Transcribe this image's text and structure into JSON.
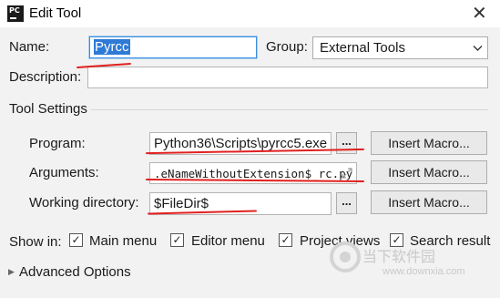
{
  "window": {
    "title": "Edit Tool",
    "icon_text": "PC"
  },
  "form": {
    "name_label": "Name:",
    "name_value": "Pyrcc",
    "group_label": "Group:",
    "group_value": "External Tools",
    "description_label": "Description:",
    "description_value": ""
  },
  "tool_settings": {
    "section_title": "Tool Settings",
    "program_label": "Program:",
    "program_value": "Python36\\Scripts\\pyrcc5.exe",
    "arguments_label": "Arguments:",
    "arguments_value": ".eNameWithoutExtension$_rc.py",
    "working_dir_label": "Working directory:",
    "working_dir_value": "$FileDir$",
    "browse_label": "...",
    "insert_macro_label": "Insert Macro..."
  },
  "show_in": {
    "label": "Show in:",
    "options": [
      {
        "label": "Main menu",
        "checked": true
      },
      {
        "label": "Editor menu",
        "checked": true
      },
      {
        "label": "Project views",
        "checked": true
      },
      {
        "label": "Search result",
        "checked": true
      }
    ]
  },
  "advanced": {
    "label": "Advanced Options"
  },
  "watermark": {
    "brand": "当下软件园",
    "url": "www.downxia.com"
  },
  "colors": {
    "accent": "#2e7ad6",
    "annotation": "#e0201f"
  }
}
